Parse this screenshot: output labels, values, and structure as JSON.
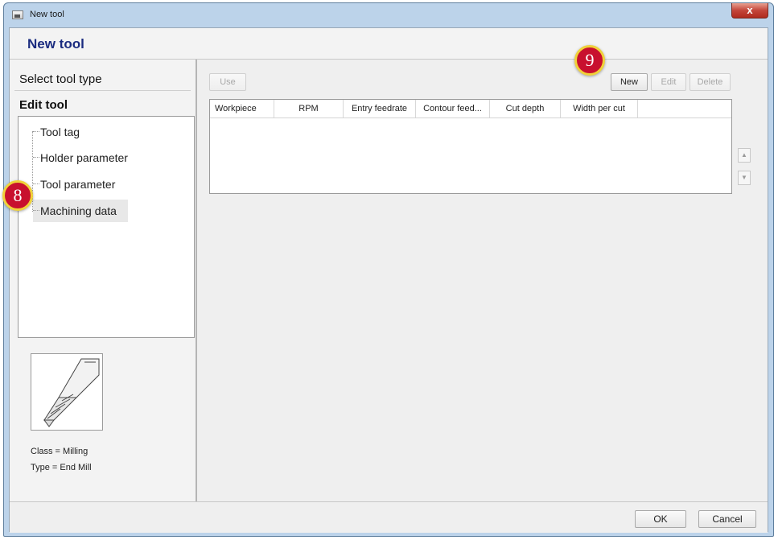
{
  "window": {
    "title": "New tool",
    "close_glyph": "x"
  },
  "header": {
    "title": "New tool"
  },
  "nav": {
    "select_tool_type": "Select tool type",
    "edit_tool": "Edit tool",
    "tree_items": [
      {
        "label": "Tool tag"
      },
      {
        "label": "Holder parameter"
      },
      {
        "label": "Tool parameter"
      },
      {
        "label": "Machining data",
        "selected": true
      }
    ]
  },
  "tool_info": {
    "image_icon": "end-mill-icon",
    "class_text": "Class = Milling",
    "type_text": "Type = End Mill"
  },
  "toolbar": {
    "use_label": "Use",
    "new_label": "New",
    "edit_label": "Edit",
    "delete_label": "Delete"
  },
  "table": {
    "columns": [
      "Workpiece",
      "RPM",
      "Entry feedrate",
      "Contour feed...",
      "Cut depth",
      "Width per cut"
    ],
    "rows": []
  },
  "side_buttons": {
    "move_up_icon": "arrow-up-icon",
    "move_down_icon": "arrow-down-icon"
  },
  "footer": {
    "ok_label": "OK",
    "cancel_label": "Cancel"
  },
  "callouts": {
    "badge_8": "8",
    "badge_9": "9"
  },
  "colors": {
    "header_title": "#1b2c80",
    "badge_fill": "#c8102e",
    "badge_ring": "#f0d23a"
  }
}
